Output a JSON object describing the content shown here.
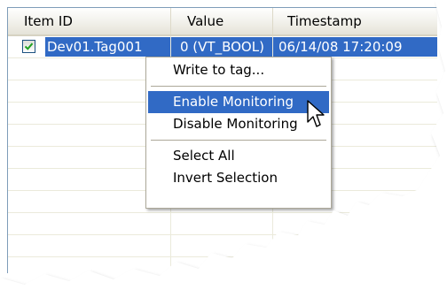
{
  "columns": {
    "item_id": "Item ID",
    "value": "Value",
    "timestamp": "Timestamp"
  },
  "selected_row": {
    "checked": true,
    "item_id": "Dev01.Tag001",
    "value": "0 (VT_BOOL)",
    "timestamp": "06/14/08 17:20:09"
  },
  "context_menu": {
    "write": "Write to tag...",
    "enable": "Enable Monitoring",
    "disable": "Disable Monitoring",
    "select_all": "Select All",
    "invert": "Invert Selection",
    "highlighted": "Enable Monitoring"
  },
  "colors": {
    "selection": "#316ac5",
    "header_bg": "#ece9d8",
    "grid": "#ebeadb"
  }
}
